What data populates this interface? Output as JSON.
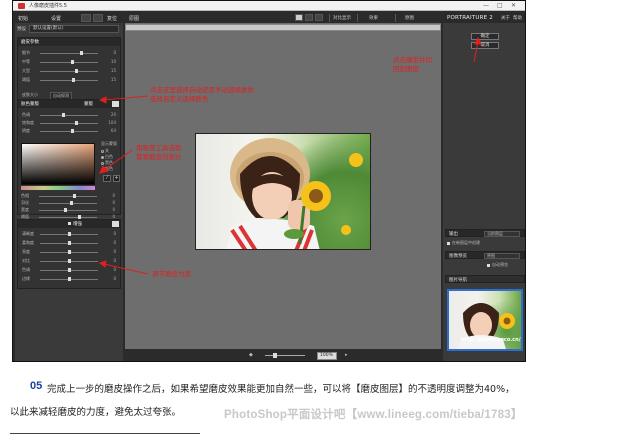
{
  "window": {
    "title": "人像磨皮插件5.5",
    "buttons": [
      "—",
      "□",
      "✕"
    ]
  },
  "left_panel": {
    "tabs": [
      "初始",
      "设置",
      "复位"
    ],
    "preset_label": "预设",
    "preset_value": "默认设置(默认)",
    "section1_title": "磨皮参数",
    "section1_sliders": [
      {
        "label": "细节",
        "value": "0",
        "pos": 0.72
      },
      {
        "label": "中等",
        "value": "10",
        "pos": 0.55
      },
      {
        "label": "大型",
        "value": "15",
        "pos": 0.62
      },
      {
        "label": "阈值",
        "value": "15",
        "pos": 0.58
      }
    ],
    "profile_label": "皮肤大小",
    "profile_value": "自动探测",
    "section2_title": "肤色蒙版",
    "section2_mode": "蒙版",
    "section2_sliders": [
      {
        "label": "色调",
        "value": "20",
        "pos": 0.4
      },
      {
        "label": "饱和度",
        "value": "104",
        "pos": 0.62
      },
      {
        "label": "明度",
        "value": "64",
        "pos": 0.55
      }
    ],
    "radio_title": "显示蒙版",
    "radio_options": [
      "关",
      "白色",
      "黑色",
      "颜色"
    ],
    "section2_sliders_b": [
      {
        "label": "色相",
        "value": "0",
        "pos": 0.6
      },
      {
        "label": "羽化",
        "value": "0",
        "pos": 0.55
      },
      {
        "label": "宽度",
        "value": "0",
        "pos": 0.45
      },
      {
        "label": "阈值",
        "value": "0",
        "pos": 0.7
      }
    ],
    "section3_check": "增强",
    "section3_sliders": [
      {
        "label": "清晰度",
        "value": "0",
        "pos": 0.5
      },
      {
        "label": "柔和度",
        "value": "0",
        "pos": 0.5
      },
      {
        "label": "亮度",
        "value": "0",
        "pos": 0.5
      },
      {
        "label": "对比",
        "value": "0",
        "pos": 0.5
      },
      {
        "label": "色调",
        "value": "0",
        "pos": 0.5
      },
      {
        "label": "边缘",
        "value": "0",
        "pos": 0.5
      }
    ]
  },
  "center": {
    "label": "原图",
    "toolbar": [
      "对比显示",
      "效果",
      "原图"
    ],
    "zoom_value": "100%"
  },
  "right_panel": {
    "logo": "PORTRAITURE 2",
    "top_buttons": [
      "关于",
      "帮助"
    ],
    "ok_label": "确定",
    "cancel_label": "取消",
    "output_label": "输出",
    "output_value": "当前图层",
    "output_check": "在新图层中创建",
    "preview_label": "图像预览",
    "preview_value": "原图",
    "preview_check": "自动预览",
    "nav_label": "图片导航",
    "watermark": "http://photo.poco.cn/"
  },
  "annotations": {
    "ok_note": [
      "点击确定并切",
      "回到图层"
    ],
    "mask_note": [
      "点击这里选择自动还是手动选择肤色",
      "选择自定义选择肤色"
    ],
    "eyedropper_note": [
      "用吸管工具选取",
      "需要磨皮的部分"
    ],
    "strength_note": "调节磨皮力度"
  },
  "article": {
    "step": "05",
    "line1": "完成上一步的磨皮操作之后，如果希望磨皮效果能更加自然一些，可以将【磨皮图层】的不透明度调整为40%，",
    "line2": "以此来减轻磨皮的力度，避免太过夸张。",
    "site_watermark": "PhotoShop平面设计吧【www.lineeg.com/tieba/1783】"
  }
}
